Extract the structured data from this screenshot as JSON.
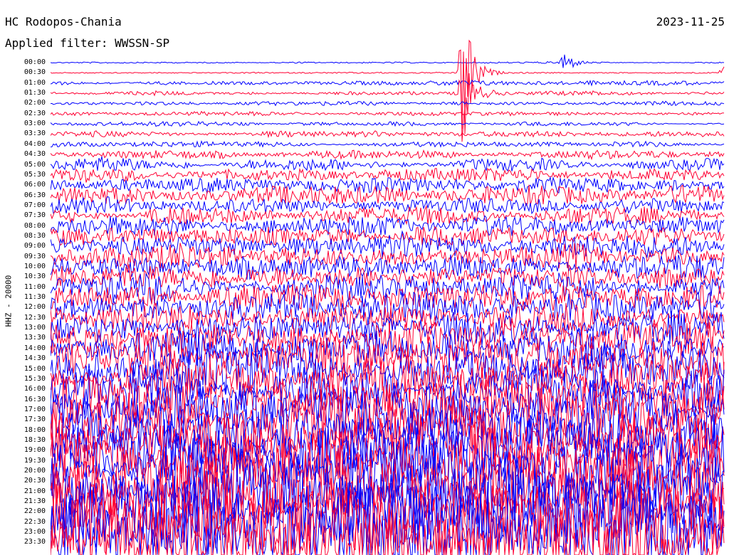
{
  "header": {
    "station": "HC Rodopos-Chania",
    "date": "2023-11-25",
    "filter": "Applied filter: WWSSN-SP"
  },
  "chart_data": {
    "type": "helicorder",
    "title": "HC Rodopos-Chania",
    "date": "2023-11-25",
    "filter": "WWSSN-SP",
    "ylabel": "HHZ - 20000",
    "row_interval_minutes": 30,
    "y_tick_labels": [
      "00:00",
      "00:30",
      "01:00",
      "01:30",
      "02:00",
      "02:30",
      "03:00",
      "03:30",
      "04:00",
      "04:30",
      "05:00",
      "05:30",
      "06:00",
      "06:30",
      "07:00",
      "07:30",
      "08:00",
      "08:30",
      "09:00",
      "09:30",
      "10:00",
      "10:30",
      "11:00",
      "11:30",
      "12:00",
      "12:30",
      "13:00",
      "13:30",
      "14:00",
      "14:30",
      "15:00",
      "15:30",
      "16:00",
      "16:30",
      "17:00",
      "17:30",
      "18:00",
      "18:30",
      "19:00",
      "19:30",
      "20:00",
      "20:30",
      "21:00",
      "21:30",
      "22:00",
      "22:30",
      "23:00",
      "23:30"
    ],
    "trace_colors": [
      "#0000ff",
      "#ff0033"
    ],
    "relative_amplitude": [
      0.1,
      0.1,
      0.3,
      0.3,
      0.3,
      0.3,
      0.3,
      0.4,
      0.4,
      0.6,
      0.9,
      1.0,
      1.1,
      1.2,
      1.2,
      1.3,
      1.4,
      1.5,
      1.6,
      1.7,
      1.8,
      1.9,
      2.0,
      2.0,
      2.0,
      2.2,
      2.4,
      2.6,
      2.8,
      3.0,
      3.2,
      3.4,
      3.6,
      3.8,
      4.0,
      4.2,
      4.4,
      4.6,
      4.8,
      5.0,
      5.2,
      5.4,
      5.6,
      5.8,
      6.0,
      6.2,
      6.4,
      6.6
    ],
    "events": [
      {
        "row": 0,
        "position": 0.76,
        "amplitude": 1.5
      },
      {
        "row": 1,
        "position": 0.61,
        "amplitude": 10
      },
      {
        "row": 1,
        "position": 0.998,
        "amplitude": 2
      },
      {
        "row": 3,
        "position": 0.61,
        "amplitude": 6
      }
    ]
  }
}
